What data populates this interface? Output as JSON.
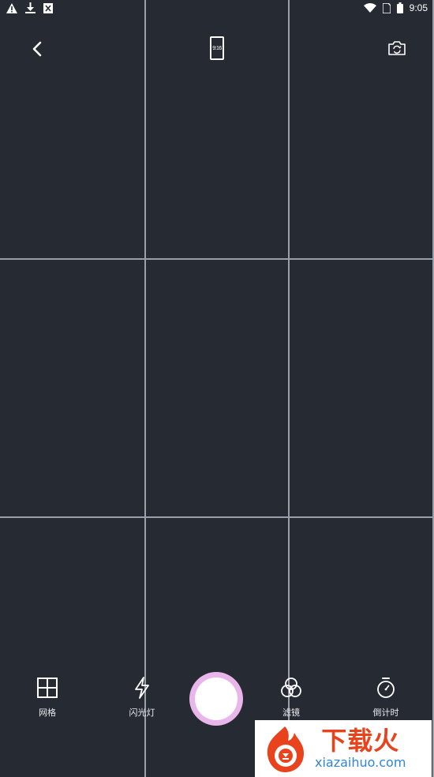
{
  "status_bar": {
    "time": "9:05",
    "icons": [
      "warning-icon",
      "download-icon",
      "notification-icon",
      "wifi-icon",
      "sim-icon",
      "battery-icon"
    ]
  },
  "top_bar": {
    "back_icon": "chevron-left-icon",
    "ratio_label": "9:16",
    "flip_icon": "camera-flip-icon"
  },
  "tools": {
    "grid_label": "网格",
    "flash_label": "闪光灯",
    "filter_label": "滤镜",
    "timer_label": "倒计时"
  },
  "colors": {
    "background": "#262a32",
    "grid_lines": "#9aa0aa",
    "shutter_ring": "#e8b6ea",
    "shutter_core": "#ffffff",
    "watermark_red": "#e8431c",
    "watermark_blue": "#2f86d6"
  },
  "watermark": {
    "title": "下载火",
    "domain": "xiazaihuo.com"
  }
}
